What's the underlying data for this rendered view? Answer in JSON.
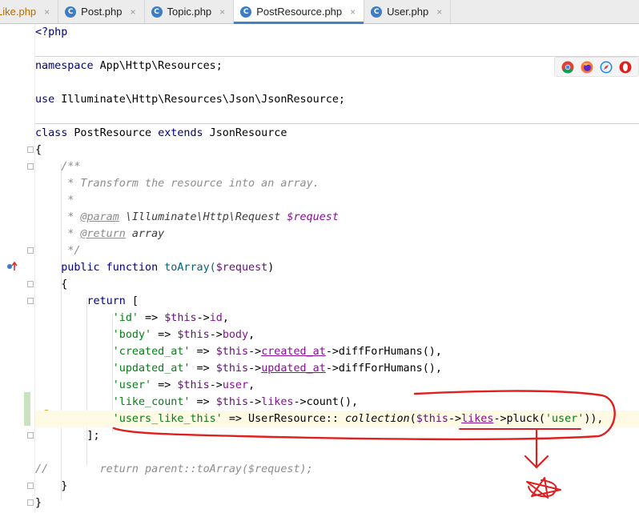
{
  "tabs": [
    {
      "label": "Like.php",
      "active": false
    },
    {
      "label": "Post.php",
      "active": false
    },
    {
      "label": "Topic.php",
      "active": false
    },
    {
      "label": "PostResource.php",
      "active": true
    },
    {
      "label": "User.php",
      "active": false
    }
  ],
  "tab_icon_text": "C",
  "tab_close": "×",
  "code": {
    "l1": "<?php",
    "ns_kw": "namespace",
    "ns_rest": " App\\Http\\Resources;",
    "use_kw": "use",
    "use_rest": " Illuminate\\Http\\Resources\\Json\\JsonResource;",
    "class_kw": "class",
    "class_name": " PostResource ",
    "extends_kw": "extends",
    "parent": " JsonResource",
    "brace_open": "{",
    "doc1": "/**",
    "doc2": " * Transform the resource into an array.",
    "doc3": " *",
    "doc4_pre": " * ",
    "doc4_tag": "@param",
    "doc4_type": " \\Illuminate\\Http\\Request ",
    "doc4_var": "$request",
    "doc5_pre": " * ",
    "doc5_tag": "@return",
    "doc5_type": " array",
    "doc6": " */",
    "public_kw": "public",
    "function_kw": " function",
    "fn_name": " toArray(",
    "fn_param": "$request",
    "fn_close": ")",
    "inner_open": "{",
    "return_kw": "return",
    "return_bracket": " [",
    "r1_key": "'id'",
    "r1_arrow": " => ",
    "r1_this": "$this",
    "r1_op": "->",
    "r1_prop": "id",
    "r1_end": ",",
    "r2_key": "'body'",
    "r2_prop": "body",
    "r3_key": "'created_at'",
    "r3_prop": "created_at",
    "r3_call": "->diffForHumans(),",
    "r4_key": "'updated_at'",
    "r4_prop": "updated_at",
    "r4_call": "->diffForHumans(),",
    "r5_key": "'user'",
    "r5_prop": "user",
    "r6_key": "'like_count'",
    "r6_prop": "likes",
    "r6_call": "->count(),",
    "r7_key": "'users_like_this'",
    "r7_mid": " => UserResource:: ",
    "r7_method": "collection",
    "r7_open": "(",
    "r7_prop": "likes",
    "r7_pluck": "->pluck(",
    "r7_arg": "'user'",
    "r7_end": ")),",
    "return_close": "];",
    "comment_slashes": "//",
    "comment_body": "        return parent::toArray($request);",
    "inner_close": "}",
    "brace_close": "}"
  },
  "colors": {
    "keyword": "#000080",
    "string": "#067d17",
    "variable": "#660e7a",
    "annotation_red": "#e0201f",
    "active_tab_underline": "#4083c9"
  },
  "icons": {
    "browsers": [
      "chrome-icon",
      "firefox-icon",
      "safari-icon",
      "opera-icon"
    ],
    "gutter": [
      "override-marker-icon",
      "lightbulb-icon"
    ]
  }
}
